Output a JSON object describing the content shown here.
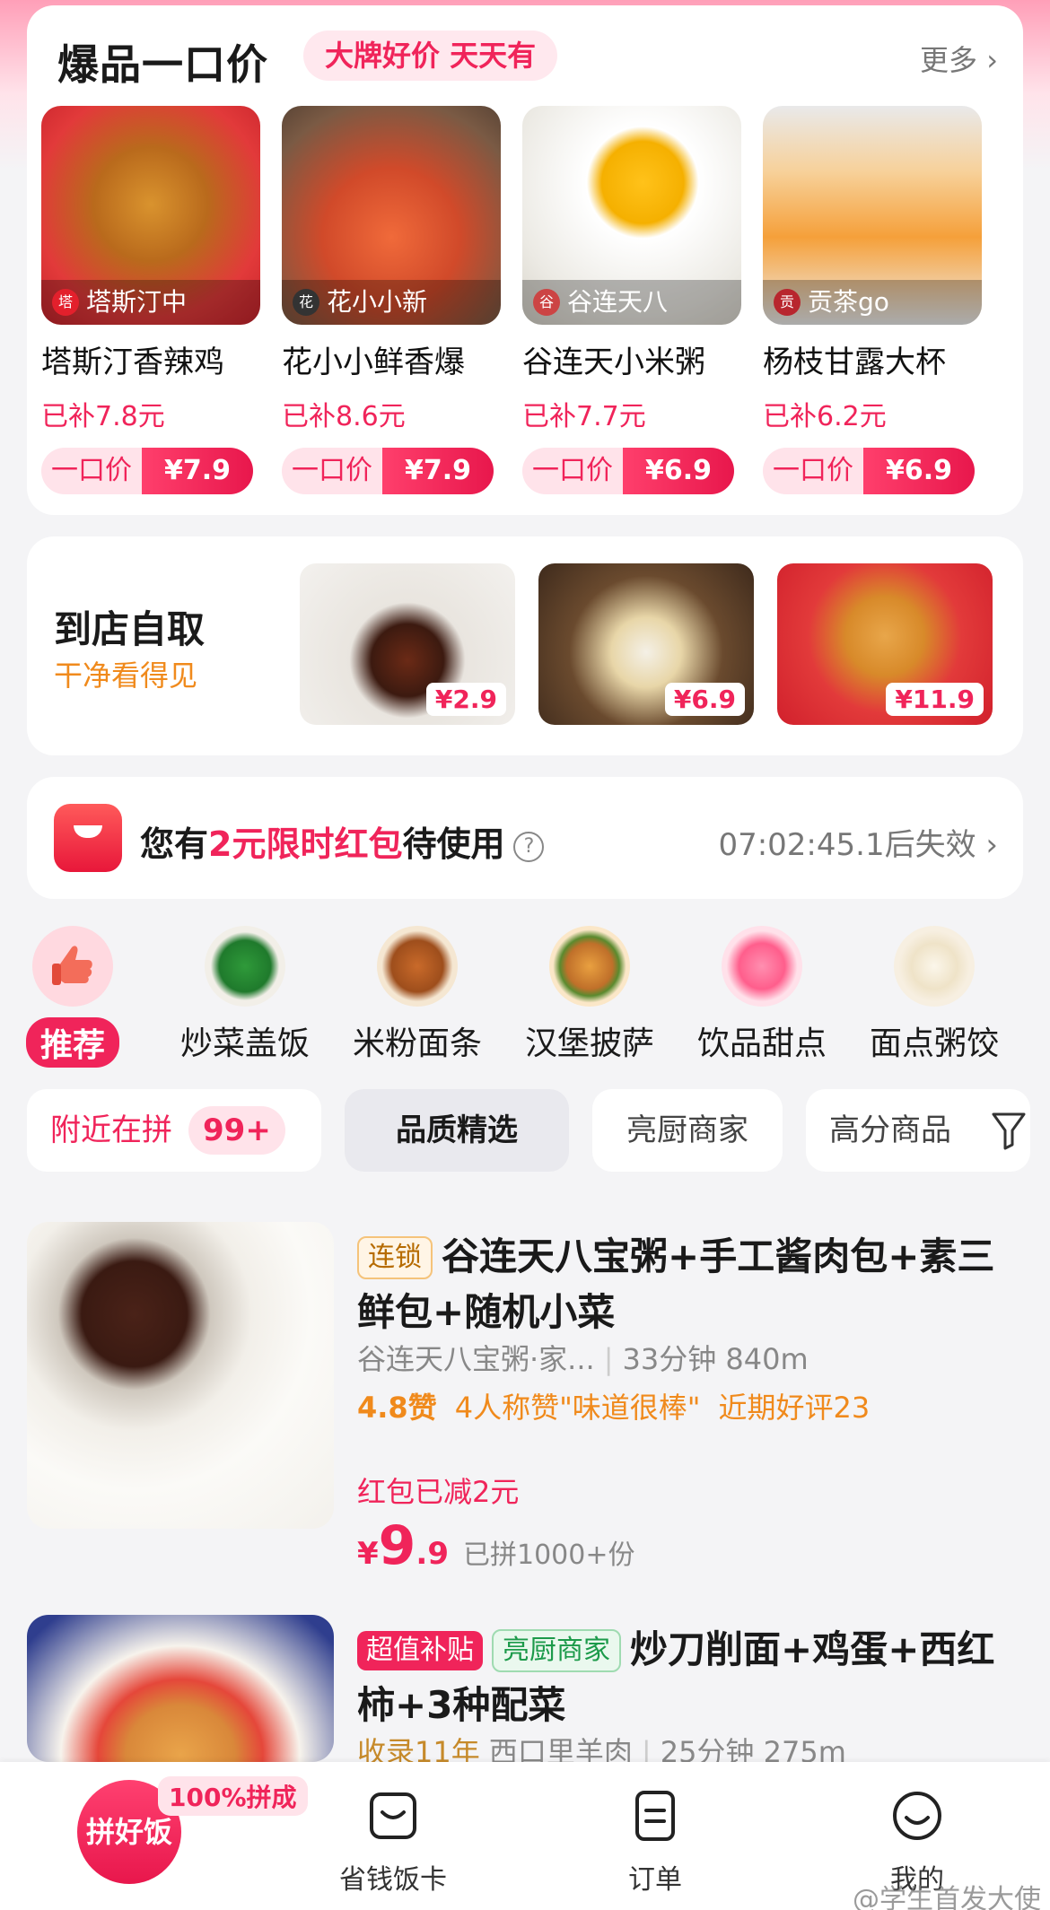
{
  "deals": {
    "title": "爆品一口价",
    "tag": "大牌好价 天天有",
    "more": "更多",
    "items": [
      {
        "brand": "塔斯汀中",
        "name": "塔斯汀香辣鸡",
        "subsidy": "已补7.8元",
        "price_label": "一口价",
        "price": "¥7.9"
      },
      {
        "brand": "花小小新",
        "name": "花小小鲜香爆",
        "subsidy": "已补8.6元",
        "price_label": "一口价",
        "price": "¥7.9"
      },
      {
        "brand": "谷连天八",
        "name": "谷连天小米粥",
        "subsidy": "已补7.7元",
        "price_label": "一口价",
        "price": "¥6.9"
      },
      {
        "brand": "贡茶go",
        "name": "杨枝甘露大杯",
        "subsidy": "已补6.2元",
        "price_label": "一口价",
        "price": "¥6.9"
      }
    ]
  },
  "pickup": {
    "title": "到店自取",
    "subtitle": "干净看得见",
    "items": [
      {
        "price": "¥2.9"
      },
      {
        "price": "¥6.9"
      },
      {
        "price": "¥11.9"
      }
    ]
  },
  "coupon": {
    "text_prefix": "您有",
    "highlight": "2元限时红包",
    "text_suffix": "待使用",
    "timer": "07:02:45.1后失效"
  },
  "categories": [
    {
      "label": "推荐"
    },
    {
      "label": "炒菜盖饭"
    },
    {
      "label": "米粉面条"
    },
    {
      "label": "汉堡披萨"
    },
    {
      "label": "饮品甜点"
    },
    {
      "label": "面点粥饺"
    }
  ],
  "filters": {
    "nearby": "附近在拼",
    "nearby_count": "99+",
    "quality": "品质精选",
    "chef": "亮厨商家",
    "score": "高分商品"
  },
  "listings": [
    {
      "tags": [
        "连锁"
      ],
      "title": "谷连天八宝粥+手工酱肉包+素三鲜包+随机小菜",
      "shop": "谷连天八宝粥·家...",
      "time": "33分钟",
      "distance": "840m",
      "score": "4.8赞",
      "praise": "4人称赞\"味道很棒\"",
      "reviews": "近期好评23",
      "promo": "红包已减2元",
      "price_currency": "¥",
      "price_int": "9",
      "price_dec": ".9",
      "sold": "已拼1000+份"
    },
    {
      "tags": [
        "超值补贴",
        "亮厨商家"
      ],
      "title": "炒刀削面+鸡蛋+西红柿+3种配菜",
      "tenure": "收录11年",
      "shop": "西口里羊肉",
      "time": "25分钟",
      "distance": "275m"
    }
  ],
  "nav": {
    "main": "拼好饭",
    "badge": "100%拼成",
    "items": [
      {
        "label": "省钱饭卡"
      },
      {
        "label": "订单"
      },
      {
        "label": "我的"
      }
    ]
  },
  "watermark": "@学生首发大使"
}
